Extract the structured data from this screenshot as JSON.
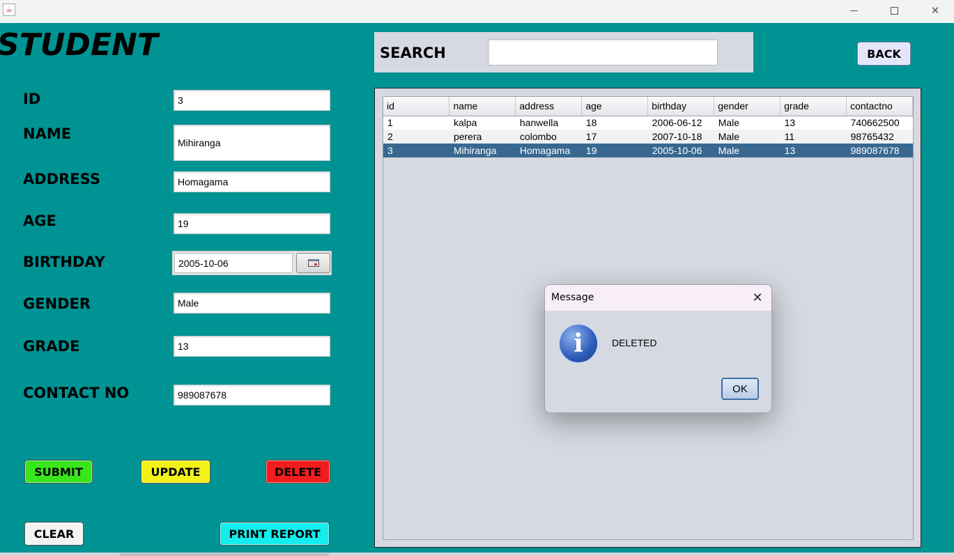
{
  "window": {
    "app_icon": "java-icon"
  },
  "form": {
    "title": "STUDENT",
    "labels": {
      "id": "ID",
      "name": "NAME",
      "address": "ADDRESS",
      "age": "AGE",
      "birthday": "BIRTHDAY",
      "gender": "GENDER",
      "grade": "GRADE",
      "contact": "CONTACT NO"
    },
    "values": {
      "id": "3",
      "name": "Mihiranga",
      "address": "Homagama",
      "age": "19",
      "birthday": "2005-10-06",
      "gender": "Male",
      "grade": "13",
      "contact": "989087678"
    },
    "buttons": {
      "submit": "SUBMIT",
      "update": "UPDATE",
      "delete": "DELETE",
      "clear": "CLEAR",
      "print": "PRINT REPORT"
    },
    "button_colors": {
      "submit": "#39e51b",
      "update": "#f2f21a",
      "delete": "#f41c1c",
      "clear": "#f2f2f2",
      "print": "#14eded"
    }
  },
  "search": {
    "label": "SEARCH",
    "value": ""
  },
  "back_button": "BACK",
  "table": {
    "columns": [
      "id",
      "name",
      "address",
      "age",
      "birthday",
      "gender",
      "grade",
      "contactno"
    ],
    "rows": [
      [
        "1",
        "kalpa",
        "hanwella",
        "18",
        "2006-06-12",
        "Male",
        "13",
        "740662500"
      ],
      [
        "2",
        "perera",
        "colombo",
        "17",
        "2007-10-18",
        "Male",
        "11",
        "98765432"
      ],
      [
        "3",
        "Mihiranga",
        "Homagama",
        "19",
        "2005-10-06",
        "Male",
        "13",
        "989087678"
      ]
    ],
    "selected_row": 2
  },
  "dialog": {
    "title": "Message",
    "message": "DELETED",
    "ok": "OK",
    "icon": "info-icon"
  },
  "colors": {
    "background": "#009393",
    "panel": "#d6d9e1",
    "selection": "#386890"
  }
}
